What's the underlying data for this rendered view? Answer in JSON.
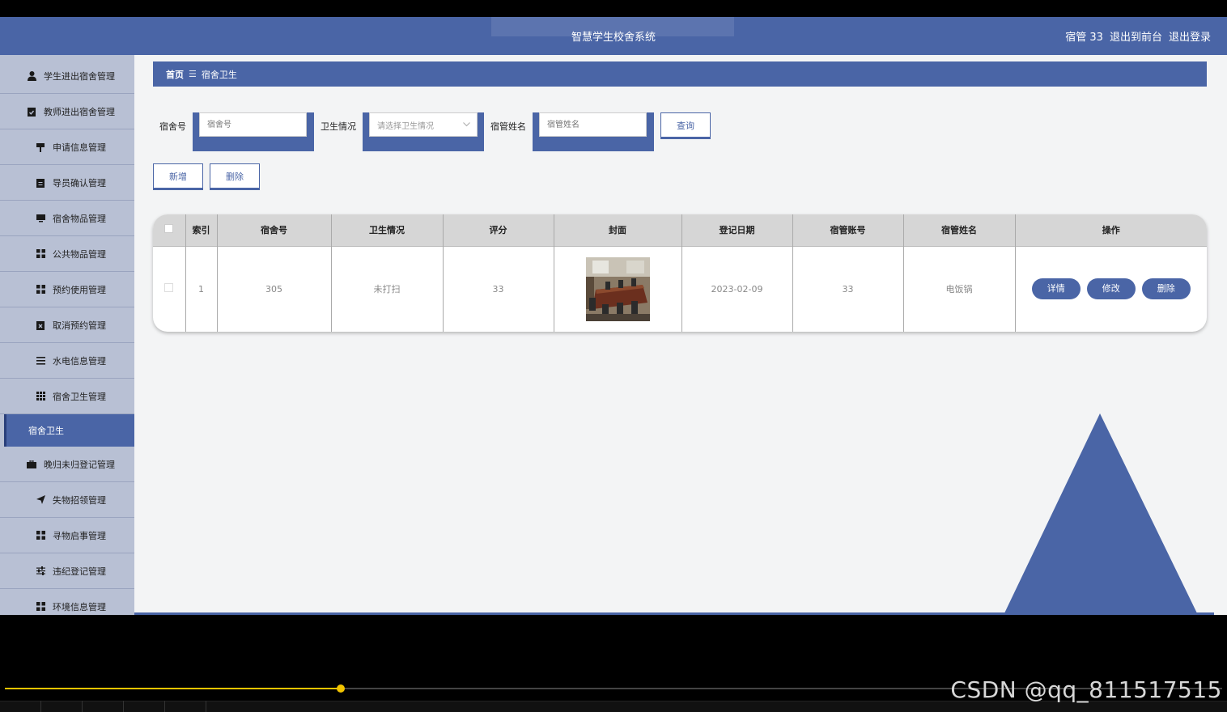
{
  "header": {
    "title": "智慧学生校舍系统",
    "user": "宿管 33",
    "to_front": "退出到前台",
    "logout": "退出登录"
  },
  "sidebar": {
    "items": [
      {
        "label": "学生进出宿舍管理",
        "icon": "user-icon"
      },
      {
        "label": "教师进出宿舍管理",
        "icon": "clipboard-check-icon"
      },
      {
        "label": "申请信息管理",
        "icon": "flag-icon"
      },
      {
        "label": "导员确认管理",
        "icon": "clipboard-icon"
      },
      {
        "label": "宿舍物品管理",
        "icon": "monitor-icon"
      },
      {
        "label": "公共物品管理",
        "icon": "grid-icon"
      },
      {
        "label": "预约使用管理",
        "icon": "grid-icon"
      },
      {
        "label": "取消预约管理",
        "icon": "calendar-x-icon"
      },
      {
        "label": "水电信息管理",
        "icon": "list-icon"
      },
      {
        "label": "宿舍卫生管理",
        "icon": "table-icon"
      },
      {
        "label": "宿舍卫生",
        "active": true
      },
      {
        "label": "晚归未归登记管理",
        "icon": "briefcase-icon"
      },
      {
        "label": "失物招领管理",
        "icon": "send-icon"
      },
      {
        "label": "寻物启事管理",
        "icon": "grid-icon"
      },
      {
        "label": "违纪登记管理",
        "icon": "sliders-icon"
      },
      {
        "label": "环境信息管理",
        "icon": "grid-icon"
      }
    ]
  },
  "breadcrumb": {
    "home": "首页",
    "separator": "☰",
    "current": "宿舍卫生"
  },
  "search": {
    "room_label": "宿舍号",
    "room_placeholder": "宿舍号",
    "hygiene_label": "卫生情况",
    "hygiene_placeholder": "请选择卫生情况",
    "manager_label": "宿管姓名",
    "manager_placeholder": "宿管姓名",
    "query_button": "查询"
  },
  "actions": {
    "add_button": "新增",
    "delete_button": "删除"
  },
  "table": {
    "headers": [
      "",
      "索引",
      "宿舍号",
      "卫生情况",
      "评分",
      "封面",
      "登记日期",
      "宿管账号",
      "宿管姓名",
      "操作"
    ],
    "rows": [
      {
        "index": "1",
        "room": "305",
        "hygiene": "未打扫",
        "score": "33",
        "date": "2023-02-09",
        "account": "33",
        "manager_name": "电饭锅",
        "btn_detail": "详情",
        "btn_edit": "修改",
        "btn_delete": "删除"
      }
    ]
  },
  "player": {
    "progress_fraction": 0.276,
    "watermark": "CSDN @qq_811517515"
  },
  "colors": {
    "primary": "#4a65a6",
    "sidebar_bg": "#b8c0d4",
    "content_bg": "#f3f4f5",
    "progress": "#f2c400"
  }
}
